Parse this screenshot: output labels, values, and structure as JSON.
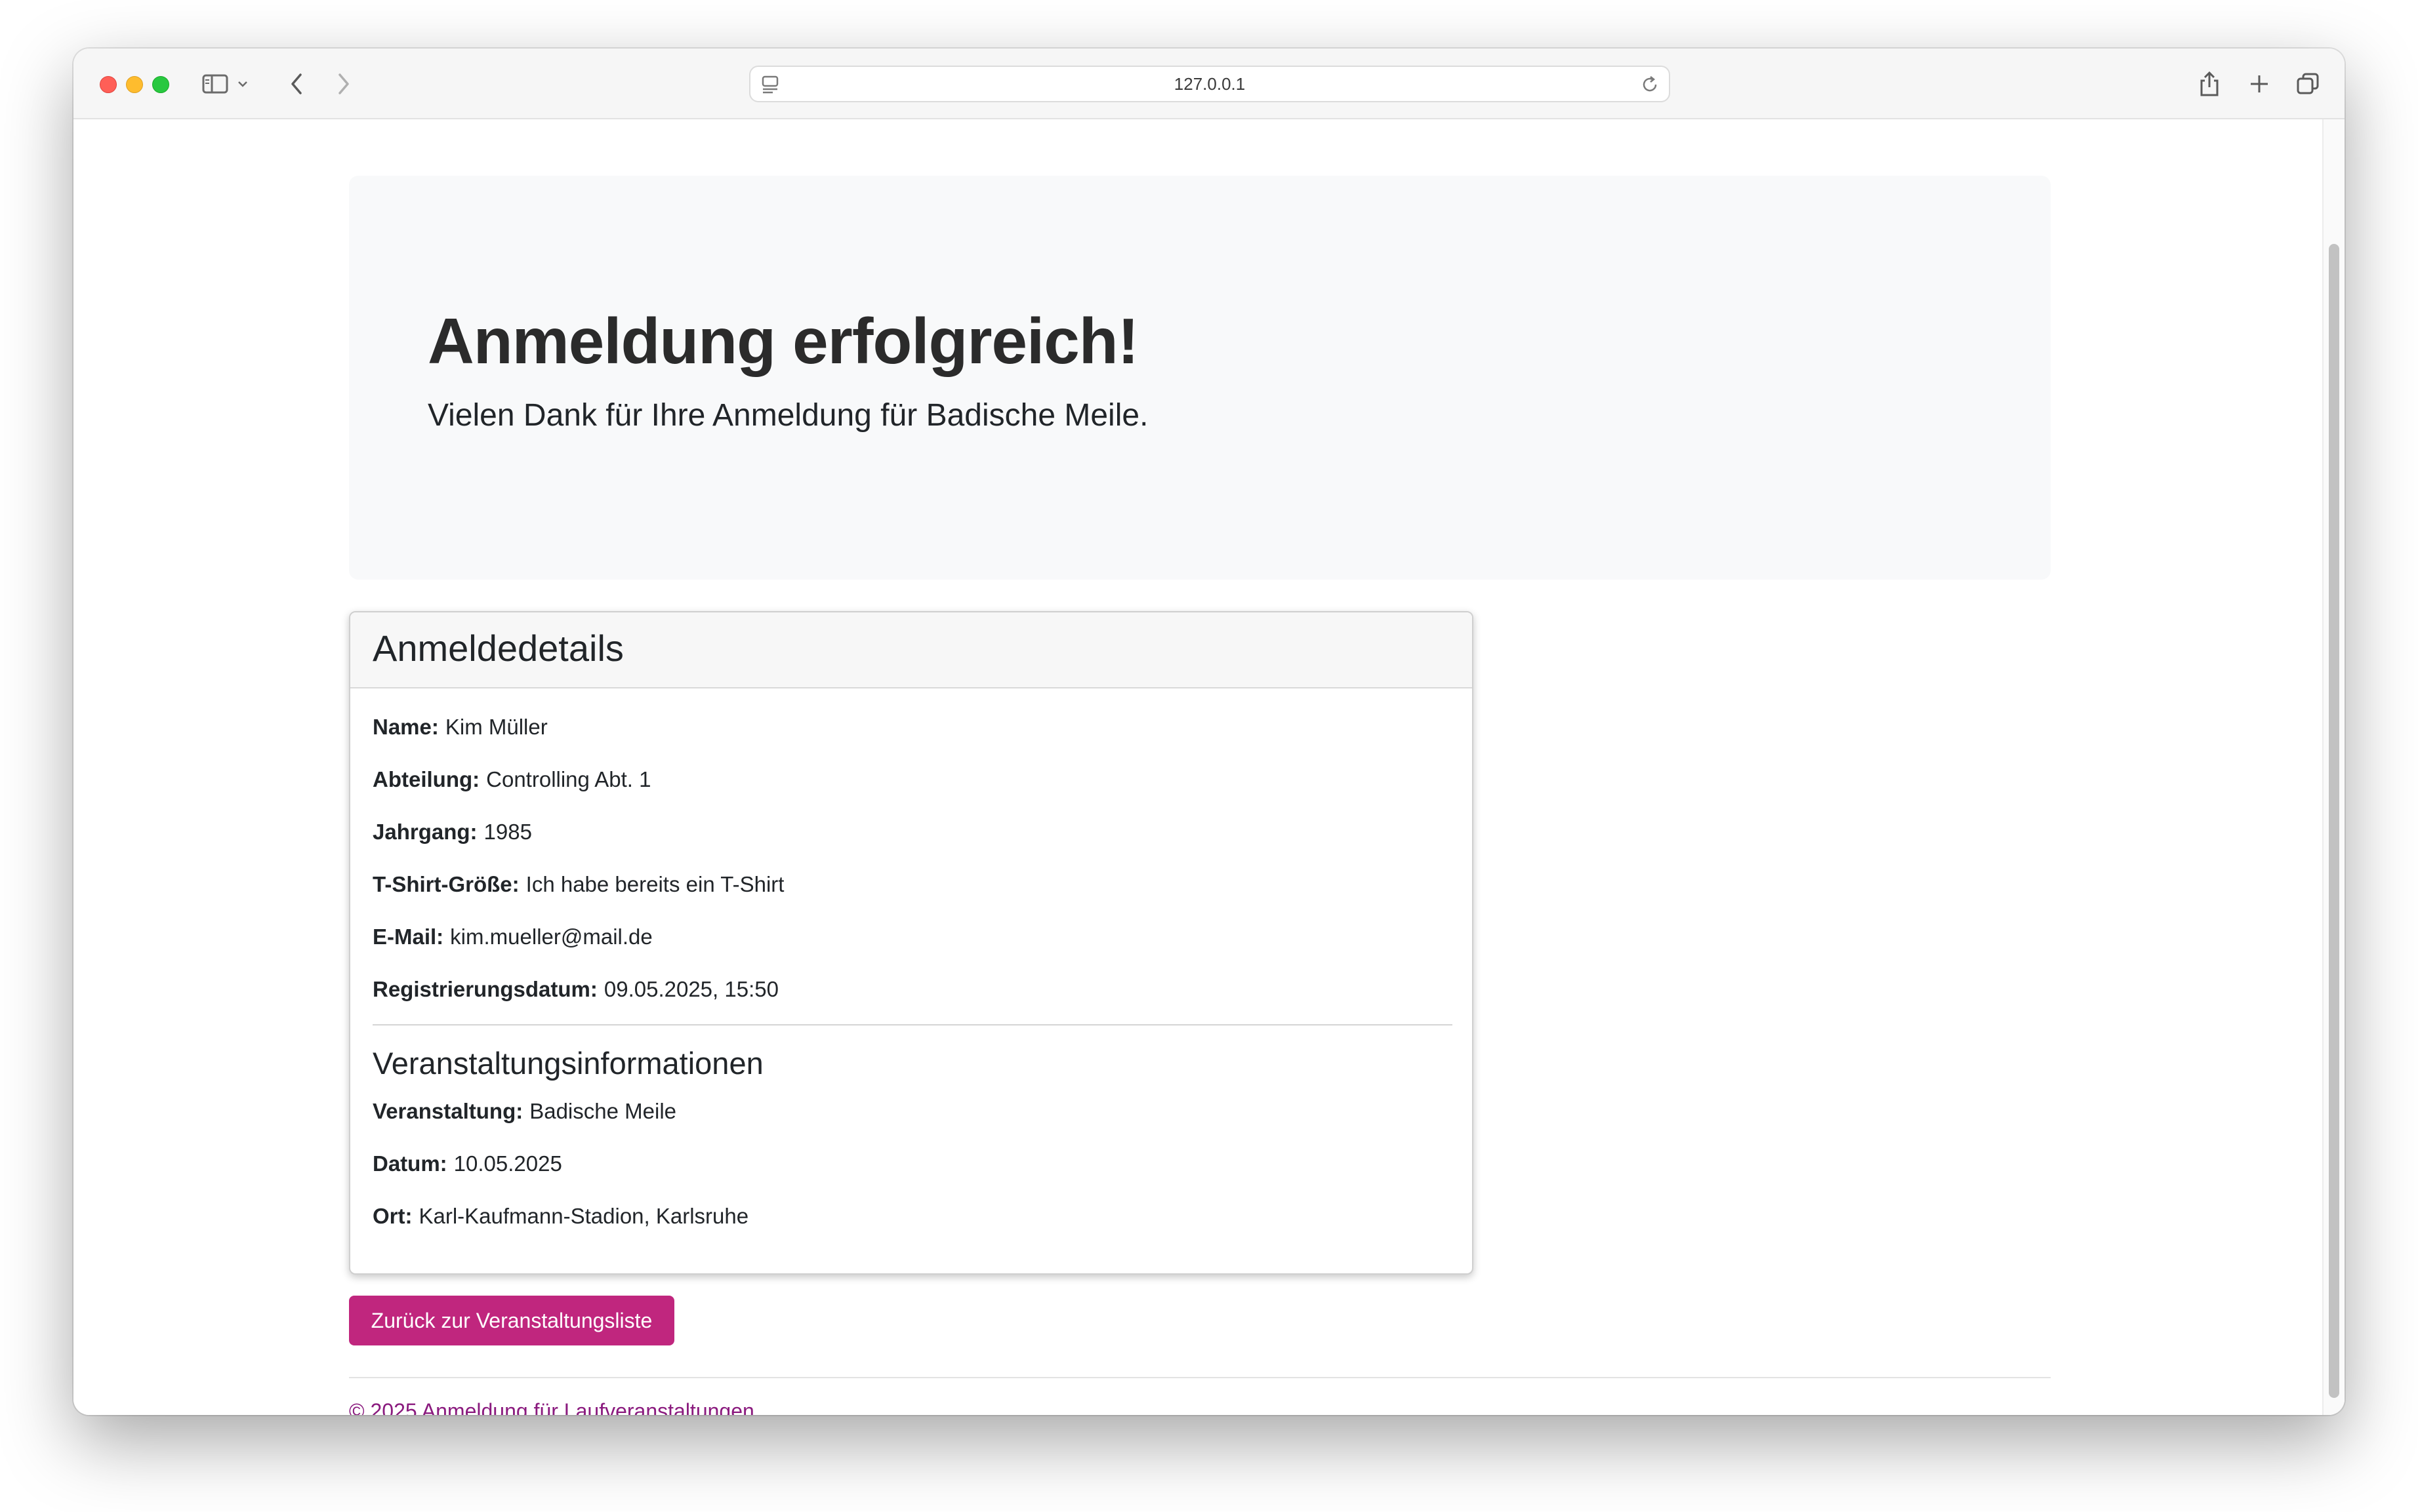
{
  "browser": {
    "url": "127.0.0.1",
    "icons": [
      "sidebar-icon",
      "chevron-down-icon",
      "back-icon",
      "forward-icon",
      "site-settings-icon",
      "reload-icon",
      "share-icon",
      "new-tab-icon",
      "tab-overview-icon"
    ]
  },
  "hero": {
    "title": "Anmeldung erfolgreich!",
    "lead": "Vielen Dank für Ihre Anmeldung für Badische Meile."
  },
  "card": {
    "header": "Anmeldedetails",
    "fields": [
      {
        "label": "Name:",
        "value": "Kim Müller"
      },
      {
        "label": "Abteilung:",
        "value": "Controlling Abt. 1"
      },
      {
        "label": "Jahrgang:",
        "value": "1985"
      },
      {
        "label": "T-Shirt-Größe:",
        "value": "Ich habe bereits ein T-Shirt"
      },
      {
        "label": "E-Mail:",
        "value": "kim.mueller@mail.de"
      },
      {
        "label": "Registrierungsdatum:",
        "value": "09.05.2025, 15:50"
      }
    ],
    "event_heading": "Veranstaltungsinformationen",
    "event_fields": [
      {
        "label": "Veranstaltung:",
        "value": "Badische Meile"
      },
      {
        "label": "Datum:",
        "value": "10.05.2025"
      },
      {
        "label": "Ort:",
        "value": "Karl-Kaufmann-Stadion, Karlsruhe"
      }
    ]
  },
  "back_button": "Zurück zur Veranstaltungsliste",
  "footer": "© 2025 Anmeldung für Laufveranstaltungen",
  "colors": {
    "accent": "#c0267e",
    "footer_text": "#8a1a7e",
    "hero_bg": "#f8f9fa"
  }
}
